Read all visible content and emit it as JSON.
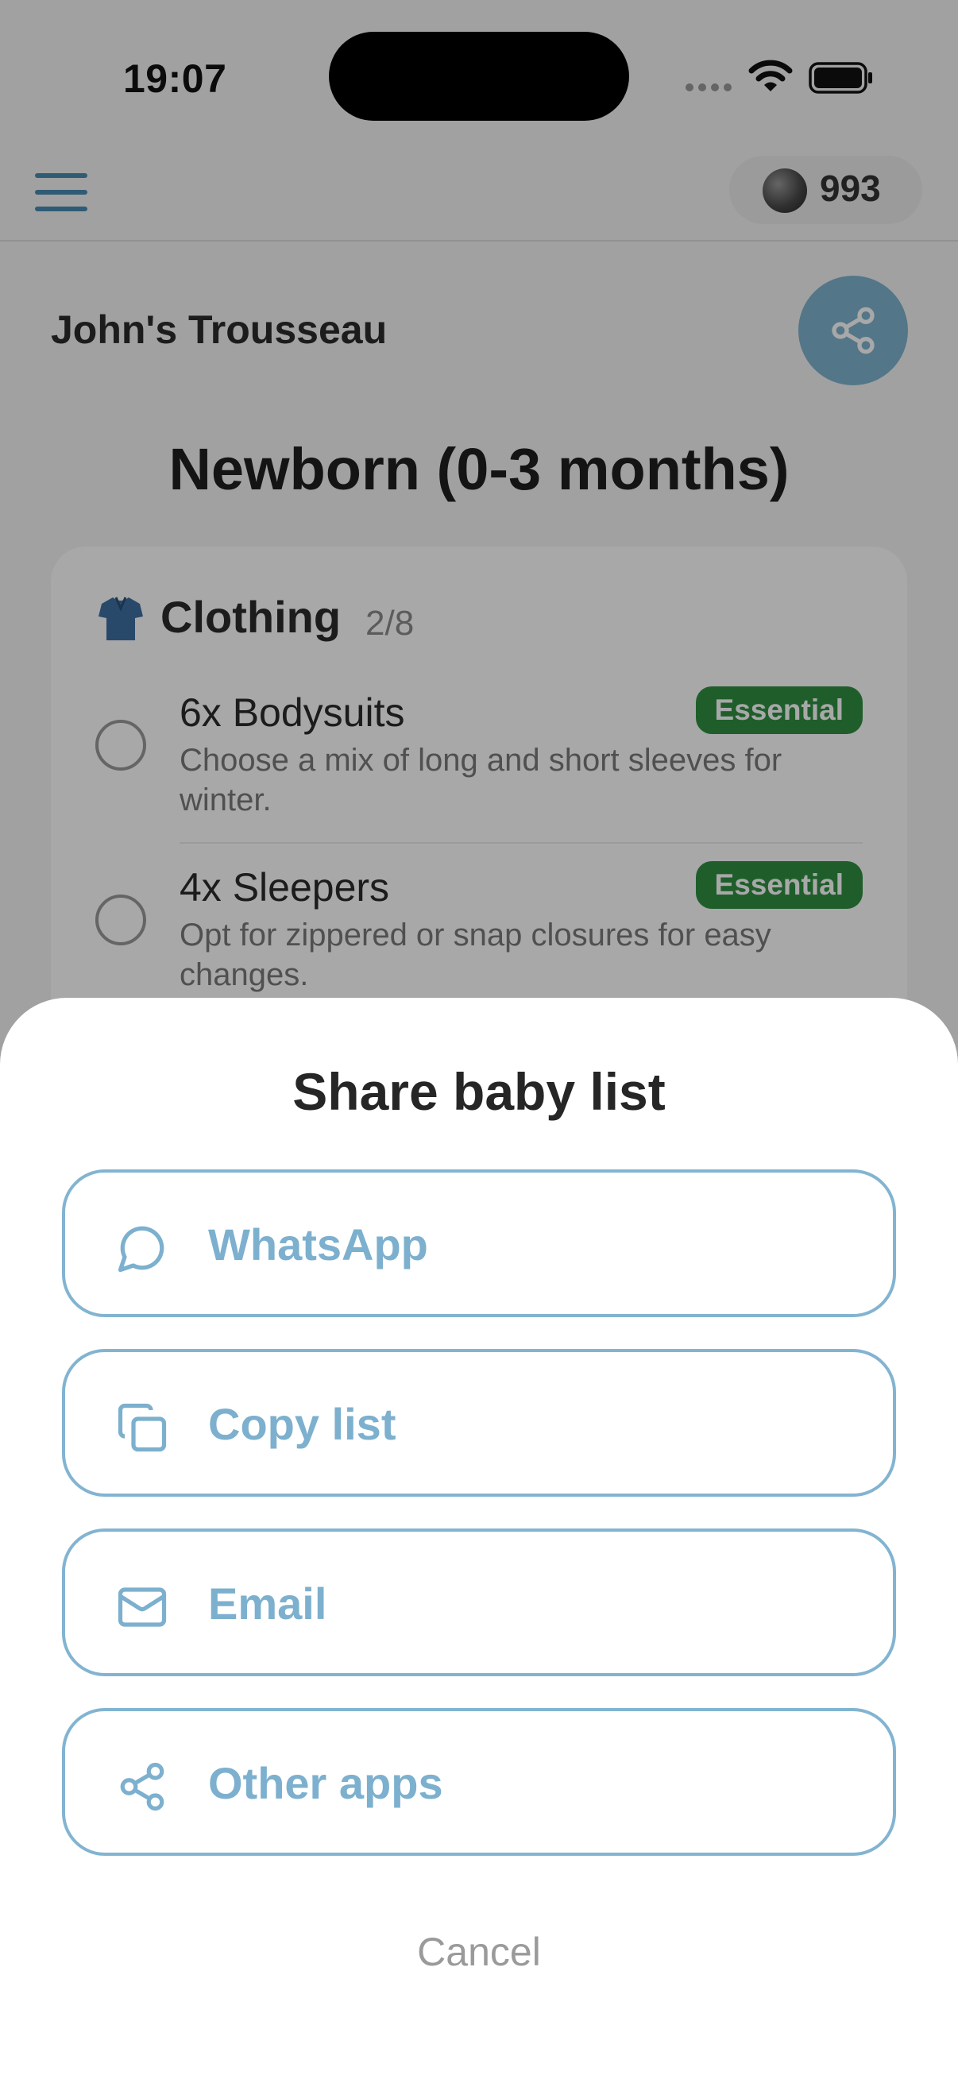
{
  "status_bar": {
    "time": "19:07"
  },
  "top_bar": {
    "coins": "993"
  },
  "list": {
    "title": "John's Trousseau",
    "stage": "Newborn (0-3 months)"
  },
  "category": {
    "title": "Clothing",
    "count": "2/8",
    "items": [
      {
        "name": "6x Bodysuits",
        "badge": "Essential",
        "description": "Choose a mix of long and short sleeves for winter."
      },
      {
        "name": "4x Sleepers",
        "badge": "Essential",
        "description": "Opt for zippered or snap closures for easy changes."
      }
    ]
  },
  "share_sheet": {
    "title": "Share baby list",
    "options": [
      {
        "label": "WhatsApp",
        "icon": "chat-bubble-icon"
      },
      {
        "label": "Copy list",
        "icon": "copy-icon"
      },
      {
        "label": "Email",
        "icon": "mail-icon"
      },
      {
        "label": "Other apps",
        "icon": "share-icon"
      }
    ],
    "cancel": "Cancel"
  },
  "colors": {
    "accent": "#7eb3cf",
    "essential_badge": "#2f8f42",
    "overlay": "rgba(0,0,0,0.34)"
  }
}
